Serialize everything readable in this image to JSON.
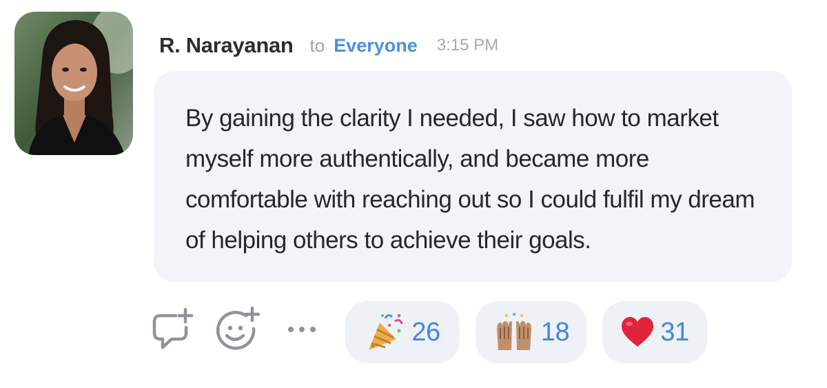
{
  "message": {
    "sender": "R. Narayanan",
    "to_word": "to",
    "recipient": "Everyone",
    "time": "3:15 PM",
    "text": "By gaining the clarity I needed, I saw how to market myself more authentically, and became more comfortable with reaching out so I could fulfil my dream of helping others to achieve their goals."
  },
  "actions": {
    "icons": [
      "add-comment-icon",
      "add-reaction-icon",
      "more-options-icon"
    ]
  },
  "reactions": [
    {
      "emoji": "party-popper",
      "count": "26"
    },
    {
      "emoji": "raising-hands",
      "count": "18"
    },
    {
      "emoji": "red-heart",
      "count": "31"
    }
  ],
  "colors": {
    "accent": "#4a90e2",
    "count": "#3f86e0",
    "bubble_bg": "#f3f4f7",
    "chip_bg": "#eef1f6"
  }
}
